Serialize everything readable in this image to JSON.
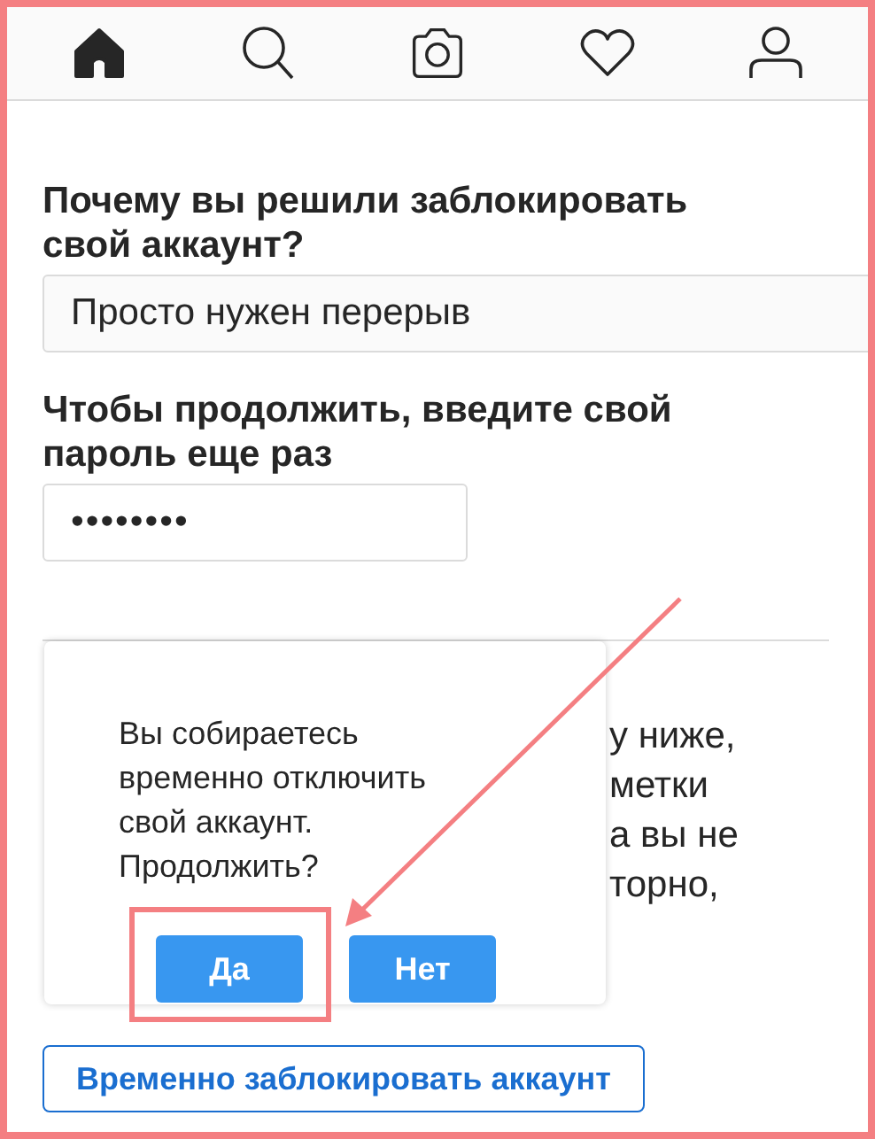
{
  "nav": [
    {
      "kind": "home",
      "selected": true
    },
    {
      "kind": "search",
      "selected": false
    },
    {
      "kind": "camera",
      "selected": false
    },
    {
      "kind": "heart",
      "selected": false
    },
    {
      "kind": "profile",
      "selected": false
    }
  ],
  "reason": {
    "label": "Почему вы решили заблокировать свой аккаунт?",
    "value": "Просто нужен перерыв"
  },
  "password": {
    "label": "Чтобы продолжить, введите свой пароль еще раз",
    "value": "••••••••"
  },
  "background_text": [
    "у ниже,",
    "метки",
    "а вы не",
    "торно,"
  ],
  "dialog": {
    "message": "Вы собираетесь временно отключить свой аккаунт. Продолжить?",
    "buttons": [
      "Да",
      "Нет"
    ]
  },
  "submit_button": "Временно заблокировать аккаунт"
}
